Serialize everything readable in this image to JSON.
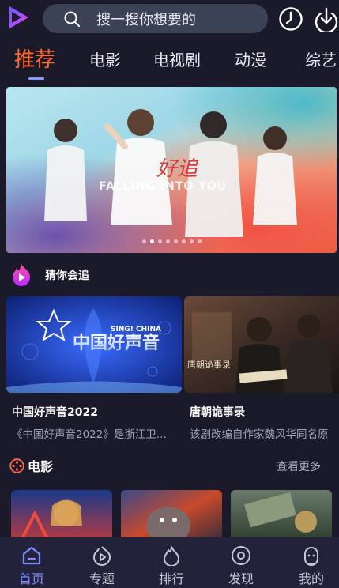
{
  "header": {
    "search_placeholder": "搜一搜你想要的",
    "icons": [
      "app-logo",
      "search-icon",
      "history-clock-icon",
      "download-icon"
    ]
  },
  "tabs": [
    {
      "label": "推荐",
      "active": true
    },
    {
      "label": "电影"
    },
    {
      "label": "电视剧"
    },
    {
      "label": "动漫"
    },
    {
      "label": "综艺"
    }
  ],
  "banner": {
    "title_art_text": "FALLING INTO YOU",
    "slide_count": 8,
    "active_slide": 1
  },
  "section_guess": {
    "title": "猜你会追",
    "items": [
      {
        "title": "中国好声音2022",
        "subtitle": "《中国好声音2022》是浙江卫...",
        "poster_logo_text": "中国好声音",
        "poster_logo_en": "SING! CHINA"
      },
      {
        "title": "唐朝诡事录",
        "subtitle": "该剧改编自作家魏风华同名原"
      }
    ]
  },
  "section_movies": {
    "title": "电影",
    "more_label": "查看更多"
  },
  "bottom_nav": [
    {
      "label": "首页",
      "icon": "home-icon",
      "active": true
    },
    {
      "label": "专题",
      "icon": "topic-play-icon"
    },
    {
      "label": "排行",
      "icon": "ranking-flame-icon"
    },
    {
      "label": "发现",
      "icon": "discover-icon"
    },
    {
      "label": "我的",
      "icon": "profile-icon"
    }
  ],
  "colors": {
    "background": "#1b1a2b",
    "active_tab": "#ff6a2a",
    "nav_active": "#7d8cff",
    "search_bg": "#3b4255"
  }
}
